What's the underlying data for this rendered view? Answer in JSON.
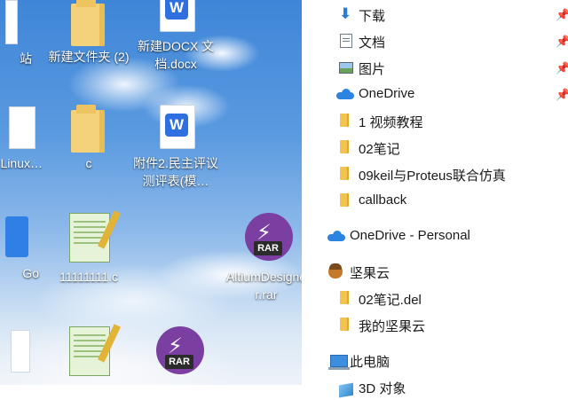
{
  "desktop": {
    "icons": [
      {
        "label": "站",
        "type": "cut"
      },
      {
        "label": "新建文件夹 (2)",
        "type": "folder"
      },
      {
        "label": "新建DOCX 文档.docx",
        "type": "wps"
      },
      {
        "label": "原子】Linux…",
        "type": "cut"
      },
      {
        "label": "c",
        "type": "folder"
      },
      {
        "label": "附件2.民主评议测评表(模…",
        "type": "wps"
      },
      {
        "label": "Go",
        "type": "cut"
      },
      {
        "label": "11111111.c",
        "type": "notepad"
      },
      {
        "label": "AltiumDesigner.rar",
        "type": "rar"
      },
      {
        "label": "",
        "type": "notepad"
      },
      {
        "label": "",
        "type": "rar"
      }
    ],
    "rar_tag": "RAR",
    "wps_glyph": "W"
  },
  "nav": {
    "quick_access": [
      {
        "label": "下载",
        "icon": "download-icon",
        "pinned": true
      },
      {
        "label": "文档",
        "icon": "document-icon",
        "pinned": true
      },
      {
        "label": "图片",
        "icon": "picture-icon",
        "pinned": true
      },
      {
        "label": "OneDrive",
        "icon": "onedrive-icon",
        "pinned": true
      },
      {
        "label": "1 视频教程",
        "icon": "folder-icon",
        "pinned": false
      },
      {
        "label": "02笔记",
        "icon": "folder-icon",
        "pinned": false
      },
      {
        "label": "09keil与Proteus联合仿真",
        "icon": "folder-icon",
        "pinned": false
      },
      {
        "label": "callback",
        "icon": "folder-icon",
        "pinned": false
      }
    ],
    "onedrive_personal": "OneDrive - Personal",
    "jianguoyun": {
      "label": "坚果云",
      "children": [
        "02笔记.del",
        "我的坚果云"
      ]
    },
    "this_pc": "此电脑",
    "objects_3d": "3D 对象",
    "pin_glyph": "📌"
  }
}
